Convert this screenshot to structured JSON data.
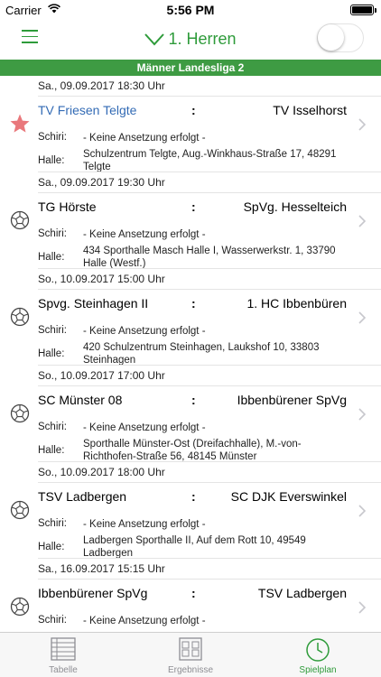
{
  "status_bar": {
    "carrier": "Carrier",
    "time": "5:56 PM"
  },
  "nav": {
    "title": "1. Herren",
    "accent": "#2e9b3a"
  },
  "league": {
    "name": "Männer Landesliga 2",
    "color": "#3e9b43"
  },
  "labels": {
    "schiri": "Schiri:",
    "halle": "Halle:",
    "colon": ":"
  },
  "matches": [
    {
      "date": "Sa., 09.09.2017 18:30 Uhr",
      "home": "TV Friesen Telgte",
      "away": "TV Isselhorst",
      "schiri": "- Keine Ansetzung erfolgt -",
      "halle": "Schulzentrum Telgte, Aug.-Winkhaus-Straße 17, 48291 Telgte",
      "icon": "star-icon",
      "favorite": true
    },
    {
      "date": "Sa., 09.09.2017 19:30 Uhr",
      "home": "TG Hörste",
      "away": "SpVg. Hesselteich",
      "schiri": "- Keine Ansetzung erfolgt -",
      "halle": "434 Sporthalle Masch Halle I, Wasserwerkstr. 1, 33790 Halle (Westf.)",
      "icon": "handball-icon",
      "favorite": false
    },
    {
      "date": "So., 10.09.2017 15:00 Uhr",
      "home": "Spvg. Steinhagen II",
      "away": "1. HC Ibbenbüren",
      "schiri": "- Keine Ansetzung erfolgt -",
      "halle": "420 Schulzentrum Steinhagen, Laukshof 10, 33803 Steinhagen",
      "icon": "handball-icon",
      "favorite": false
    },
    {
      "date": "So., 10.09.2017 17:00 Uhr",
      "home": "SC Münster 08",
      "away": "Ibbenbürener SpVg",
      "schiri": "- Keine Ansetzung erfolgt -",
      "halle": "Sporthalle Münster-Ost (Dreifachhalle), M.-von-Richthofen-Straße 56, 48145 Münster",
      "icon": "handball-icon",
      "favorite": false
    },
    {
      "date": "So., 10.09.2017 18:00 Uhr",
      "home": "TSV Ladbergen",
      "away": "SC DJK Everswinkel",
      "schiri": "- Keine Ansetzung erfolgt -",
      "halle": "Ladbergen Sporthalle II, Auf dem Rott 10, 49549 Ladbergen",
      "icon": "handball-icon",
      "favorite": false
    },
    {
      "date": "Sa., 16.09.2017 15:15 Uhr",
      "home": "Ibbenbürener SpVg",
      "away": "TSV Ladbergen",
      "schiri": "- Keine Ansetzung erfolgt -",
      "halle": "",
      "icon": "handball-icon",
      "favorite": false
    }
  ],
  "tabs": [
    {
      "label": "Tabelle",
      "icon": "table-icon",
      "active": false
    },
    {
      "label": "Ergebnisse",
      "icon": "results-icon",
      "active": false
    },
    {
      "label": "Spielplan",
      "icon": "clock-icon",
      "active": true
    }
  ]
}
